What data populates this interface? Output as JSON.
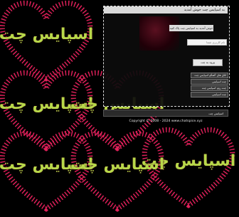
{
  "tiles": {
    "logo_text": "اسپایس چت",
    "heart_color": "#e0205a"
  },
  "panel": {
    "header_text": "به اسپایس چت خوش آمدید",
    "welcome_text": "خوش آمدید به اسپایس چت پاک کنید",
    "nick_placeholder": "نام کاربری شما",
    "enter_label": "ورود به چت",
    "menu": [
      "اتاق های گفتگو اسپایس چت",
      "چت اسپایس",
      "چت روم اسپایس چت",
      "چت اسپایس"
    ],
    "bottom_link": "اسپایس چت"
  },
  "footer": {
    "copyright": "Copyright © 2008 - 2024 www.chatspice.xyz"
  }
}
